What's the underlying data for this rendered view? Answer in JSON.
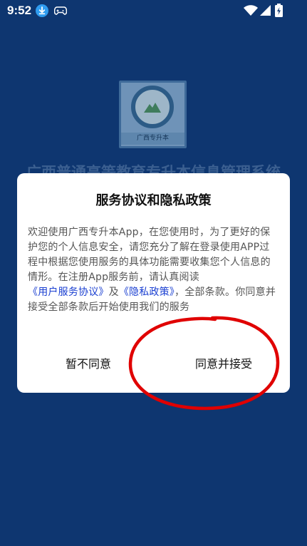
{
  "status_bar": {
    "time": "9:52",
    "icons": [
      "download-icon",
      "gamepad-icon",
      "wifi-icon",
      "signal-icon",
      "battery-charging-icon"
    ]
  },
  "background": {
    "logo_caption": "广西专升本",
    "app_title": "广西普通高等教育专升本信息管理系统",
    "color": "#0e3670"
  },
  "dialog": {
    "title": "服务协议和隐私政策",
    "body_part1": "欢迎使用广西专升本App，在您使用时，为了更好的保护您的个人信息安全，请您充分了解在登录使用APP过程中根据您使用服务的具体功能需要收集您个人信息的情形。在注册App服务前，请认真阅读",
    "link_terms": "《用户服务协议》",
    "body_and": "及",
    "link_privacy": "《隐私政策》",
    "body_part2": "，全部条款。你同意并接受全部条款后开始使用我们的服务",
    "decline_label": "暂不同意",
    "accept_label": "同意并接受",
    "link_color": "#1a3fd1"
  },
  "annotation": {
    "color": "#e00000"
  }
}
